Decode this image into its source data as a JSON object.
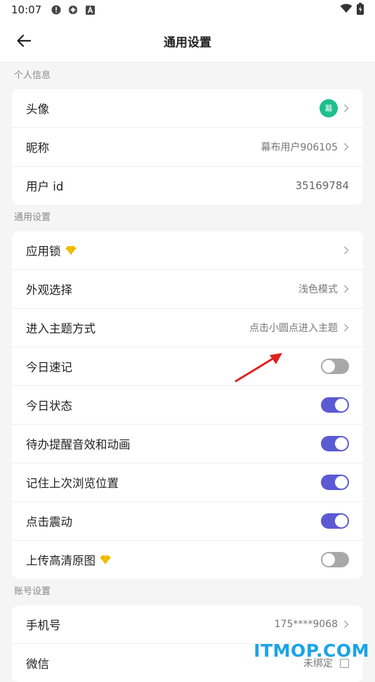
{
  "status_bar": {
    "time": "10:07"
  },
  "header": {
    "title": "通用设置"
  },
  "sections": {
    "personal": {
      "title": "个人信息",
      "avatar_label": "头像",
      "avatar_text": "幕",
      "nickname_label": "昵称",
      "nickname_value": "幕布用户906105",
      "userid_label": "用户 id",
      "userid_value": "35169784"
    },
    "general": {
      "title": "通用设置",
      "app_lock": "应用锁",
      "appearance_label": "外观选择",
      "appearance_value": "浅色模式",
      "theme_entry_label": "进入主题方式",
      "theme_entry_value": "点击小圆点进入主题",
      "quick_note": "今日速记",
      "quick_note_on": false,
      "today_status": "今日状态",
      "today_status_on": true,
      "todo_sound": "待办提醒音效和动画",
      "todo_sound_on": true,
      "remember_position": "记住上次浏览位置",
      "remember_position_on": true,
      "tap_vibrate": "点击震动",
      "tap_vibrate_on": true,
      "upload_hd": "上传高清原图",
      "upload_hd_on": false
    },
    "account": {
      "title": "账号设置",
      "phone_label": "手机号",
      "phone_value": "175****9068",
      "wechat_label": "微信",
      "wechat_value": "未绑定"
    }
  },
  "colors": {
    "accent": "#5c5ad3",
    "avatar": "#1dbf8e",
    "gem": "#f5c400",
    "arrow": "#e02020"
  },
  "watermark": "ITMOP.COM"
}
